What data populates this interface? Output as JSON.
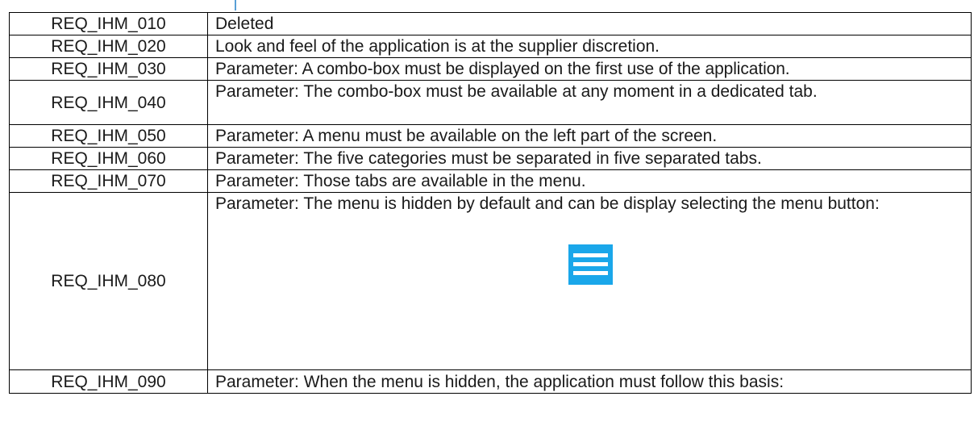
{
  "requirements": [
    {
      "id": "REQ_IHM_010",
      "text": "Deleted"
    },
    {
      "id": "REQ_IHM_020",
      "text": "Look and feel of the application is at the supplier discretion."
    },
    {
      "id": "REQ_IHM_030",
      "text": "Parameter: A combo-box must be displayed on the first use of the application."
    },
    {
      "id": "REQ_IHM_040",
      "text": "Parameter: The combo-box must be available at any moment in a dedicated tab."
    },
    {
      "id": "REQ_IHM_050",
      "text": "Parameter: A menu must be available on the left part of the screen."
    },
    {
      "id": "REQ_IHM_060",
      "text": "Parameter: The five categories must be separated in five separated tabs."
    },
    {
      "id": "REQ_IHM_070",
      "text": "Parameter: Those tabs are available in the menu."
    },
    {
      "id": "REQ_IHM_080",
      "text": "Parameter: The menu is hidden by default and can be display selecting the menu button:",
      "icon": "hamburger-menu-icon",
      "icon_color": "#1aa7ea"
    },
    {
      "id": "REQ_IHM_090",
      "text": "Parameter: When the menu is hidden, the application must follow this basis:"
    }
  ]
}
